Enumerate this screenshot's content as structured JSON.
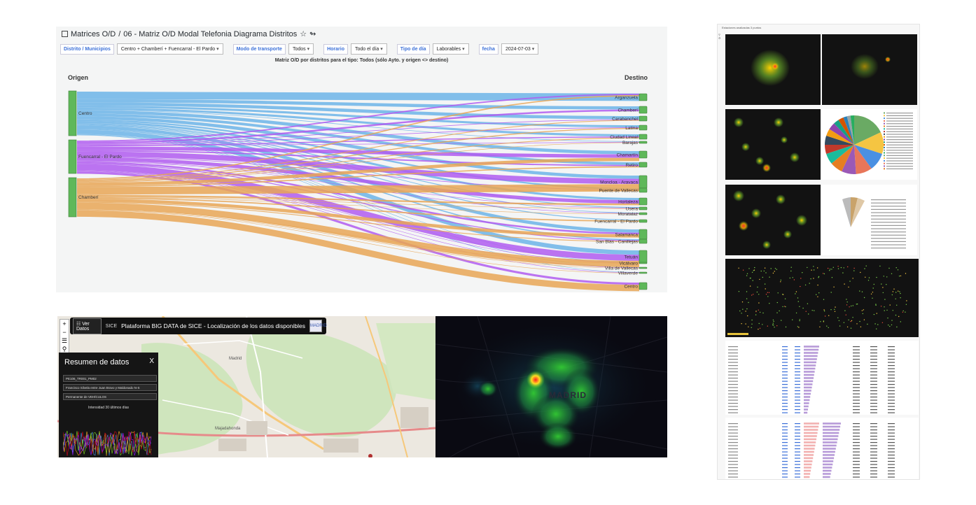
{
  "od_panel": {
    "breadcrumb_root": "Matrices O/D",
    "breadcrumb_sep": "/",
    "breadcrumb_page": "06 - Matriz O/D Modal Telefonia Diagrama Distritos",
    "variables": [
      {
        "label": "Distrito / Municipios",
        "value": "Centro + Chamberí + Fuencarral - El Pardo"
      },
      {
        "label": "Modo de transporte",
        "value": "Todos"
      },
      {
        "label": "Horario",
        "value": "Todo el día"
      },
      {
        "label": "Tipo de día",
        "value": "Laborables"
      },
      {
        "label": "fecha",
        "value": "2024-07-03"
      }
    ],
    "title": "Matriz O/D por distritos para el tipo: Todos (sólo Ayto. y origen <> destino)",
    "origin_header": "Origen",
    "destination_header": "Destino",
    "origins": [
      {
        "name": "Centro",
        "color": "#6cb4e8"
      },
      {
        "name": "Fuencarral - El Pardo",
        "color": "#b05cf0"
      },
      {
        "name": "Chamberí",
        "color": "#e8a656"
      }
    ],
    "destinations": [
      "Arganzuela",
      "Chamberí",
      "Carabanchel",
      "Latina",
      "Ciudad Lineal",
      "Barajas",
      "Chamartín",
      "Retiro",
      "Moncloa - Aravaca",
      "Puente de Vallecas",
      "Hortaleza",
      "Usera",
      "Moratalaz",
      "Fuencarral - El Pardo",
      "Salamanca",
      "San Blas - Canillejas",
      "Tetuán",
      "Vicálvaro",
      "Villa de Vallecas",
      "Villaverde",
      "Centro"
    ],
    "node_color": "#5fb85a"
  },
  "map_panel": {
    "zoom_in": "+",
    "zoom_out": "−",
    "ver_datos": "Ver Datos",
    "sice_logo": "SICE",
    "platform_title": "Plataforma BIG DATA de SICE - Localización de los datos disponibles",
    "madrid_logo": "MADRID",
    "resumen_title": "Resumen de datos",
    "resumen_close": "X",
    "fields": [
      "PE106_TR001_PM02",
      "Francisco Silvela entre Juan Bravo y Maldonado N-S",
      "Permanente de VEHÍCULOS"
    ],
    "chart_title": "Intensidad 30 últimos días",
    "map_labels": [
      "Madrid",
      "Majadahonda"
    ]
  },
  "heat_panel": {
    "city_label": "MADRID"
  },
  "dash_panel": {
    "top_label": "Estaciones analizadas 3 puntos"
  }
}
